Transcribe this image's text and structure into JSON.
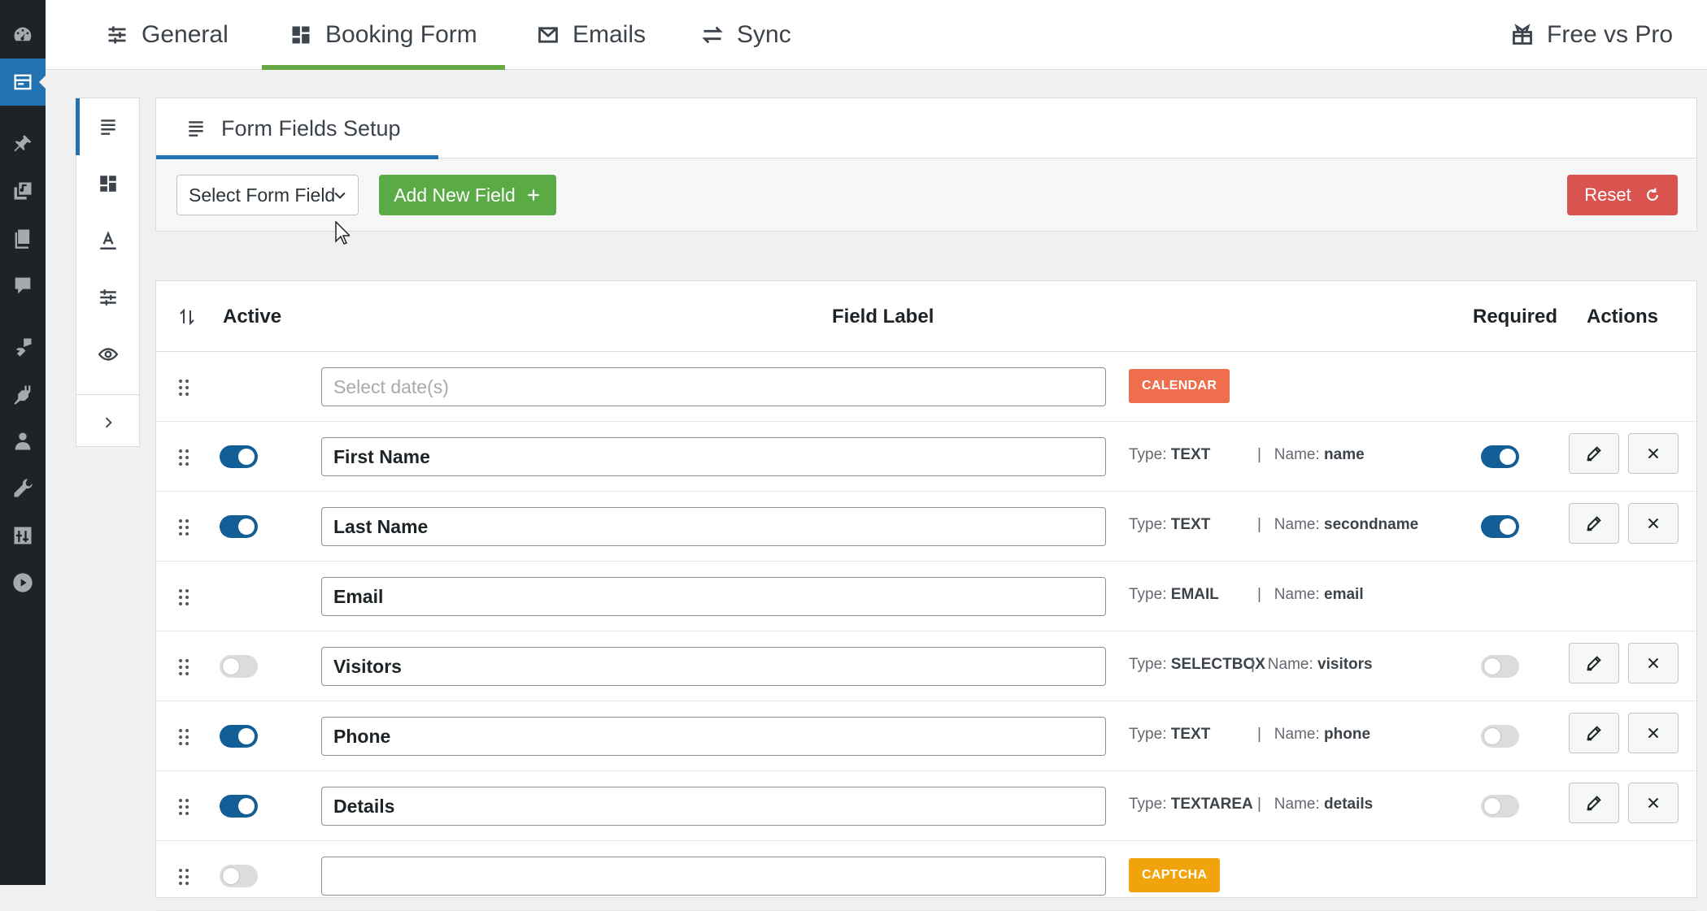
{
  "wp_menu": [
    "dashboard-icon",
    "booking-icon",
    "pin-icon",
    "media-icon",
    "pages-icon",
    "comments-icon",
    "appearance-icon",
    "plugins-icon",
    "users-icon",
    "tools-icon",
    "settings-icon",
    "play-icon"
  ],
  "tabs": {
    "general": "General",
    "booking_form": "Booking Form",
    "emails": "Emails",
    "sync": "Sync",
    "free_vs_pro": "Free vs Pro"
  },
  "panel": {
    "title": "Form Fields Setup",
    "select_label": "Select Form Field",
    "add_button": "Add New Field",
    "reset_button": "Reset"
  },
  "table": {
    "headers": {
      "active": "Active",
      "field_label": "Field Label",
      "required": "Required",
      "actions": "Actions"
    },
    "type_prefix": "Type:",
    "name_prefix": "Name:",
    "rows": [
      {
        "label": "",
        "placeholder": "Select date(s)",
        "badge": "CALENDAR",
        "badge_color": "#ee6e4e"
      },
      {
        "label": "First Name",
        "active": true,
        "type": "TEXT",
        "name": "name",
        "required": true
      },
      {
        "label": "Last Name",
        "active": true,
        "type": "TEXT",
        "name": "secondname",
        "required": true
      },
      {
        "label": "Email",
        "type": "EMAIL",
        "name": "email"
      },
      {
        "label": "Visitors",
        "active": false,
        "type": "SELECTBOX",
        "name": "visitors",
        "required": false
      },
      {
        "label": "Phone",
        "active": true,
        "type": "TEXT",
        "name": "phone",
        "required": false
      },
      {
        "label": "Details",
        "active": true,
        "type": "TEXTAREA",
        "name": "details",
        "required": false
      },
      {
        "label": "",
        "active": false,
        "badge": "CAPTCHA",
        "badge_color": "#f0a30a"
      }
    ]
  }
}
